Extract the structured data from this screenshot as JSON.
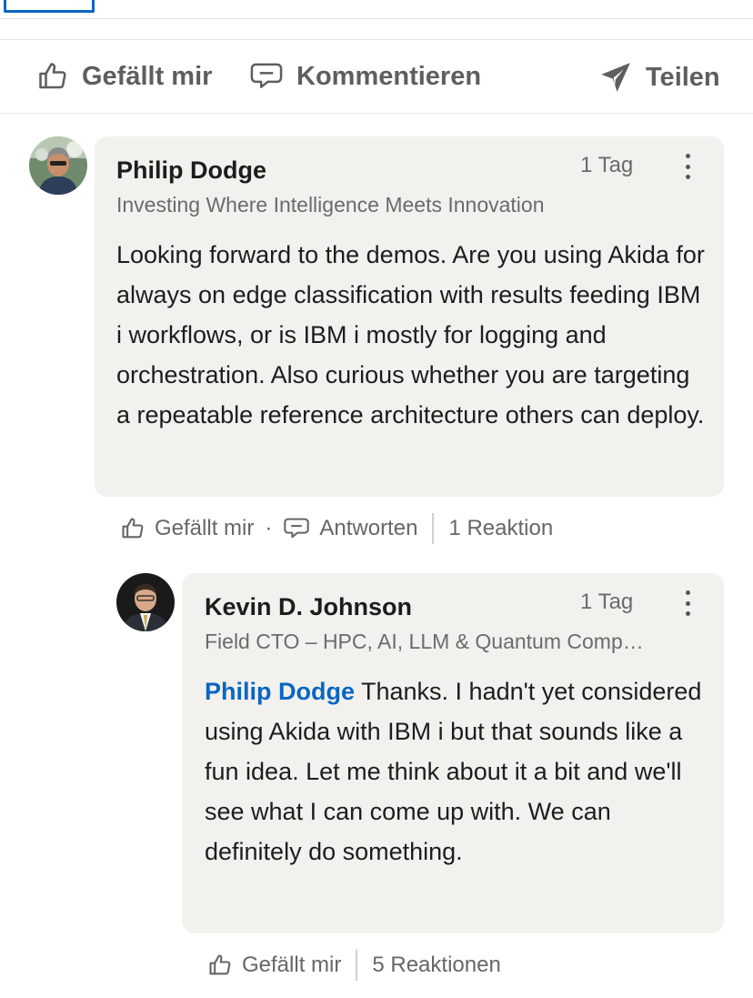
{
  "actions": {
    "like": "Gefällt mir",
    "comment": "Kommentieren",
    "share": "Teilen"
  },
  "comments": [
    {
      "author": "Philip Dodge",
      "time": "1 Tag",
      "headline": "Investing Where Intelligence Meets Innovation",
      "text": "Looking forward to the demos. Are you using Akida for always on edge classification with results feeding IBM i workflows, or is IBM i mostly for logging and orchestration. Also curious whether you are targeting a repeatable reference architecture others can deploy.",
      "like_label": "Gefällt mir",
      "dot": "·",
      "reply_label": "Antworten",
      "reactions": "1 Reaktion"
    },
    {
      "author": "Kevin D. Johnson",
      "time": "1 Tag",
      "headline": "Field CTO – HPC, AI, LLM & Quantum Comp…",
      "mention": "Philip Dodge",
      "text": " Thanks. I hadn't yet considered using Akida with IBM i but that sounds like a fun idea. Let me think about it a bit and we'll see what I can come up with.  We can definitely do something.",
      "like_label": "Gefällt mir",
      "reactions": "5 Reaktionen"
    }
  ],
  "colors": {
    "accent": "#0a66c2",
    "bubble": "#f2f1ee",
    "muted": "#666666"
  }
}
